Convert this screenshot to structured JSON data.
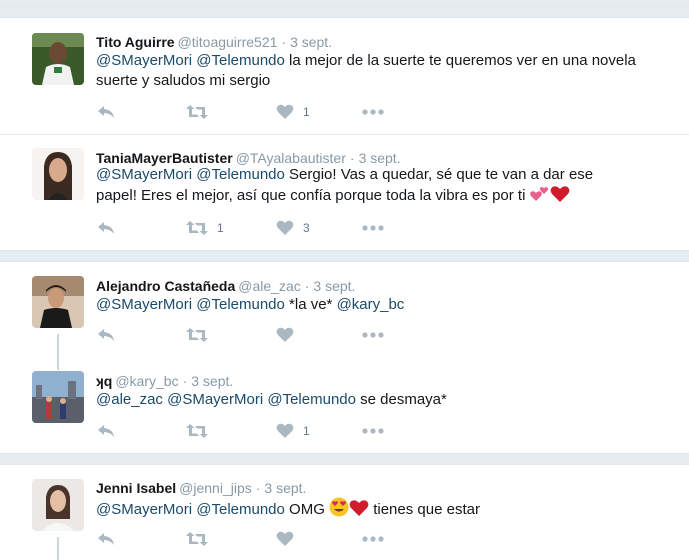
{
  "tweets": [
    {
      "name": "Tito Aguirre",
      "handle": "@titoaguirre521",
      "date": "3 sept.",
      "mentions": [
        "@SMayerMori",
        "@Telemundo"
      ],
      "body": "la mejor de la suerte te queremos ver en una novela suerte y saludos mi sergio",
      "retweets": "",
      "likes": "1"
    },
    {
      "name": "TaniaMayerBautister",
      "handle": "@TAyalabautister",
      "date": "3 sept.",
      "mentions": [
        "@SMayerMori",
        "@Telemundo"
      ],
      "body": "Sergio! Vas a quedar, sé que te van a dar ese papel! Eres el mejor, así que confía porque toda la vibra es por ti",
      "retweets": "1",
      "likes": "3"
    },
    {
      "name": "Alejandro Castañeda",
      "handle": "@ale_zac",
      "date": "3 sept.",
      "mentions": [
        "@SMayerMori",
        "@Telemundo"
      ],
      "body": "*la ve*",
      "trailing_mention": "@kary_bc",
      "retweets": "",
      "likes": ""
    },
    {
      "name": "ʞq",
      "handle": "@kary_bc",
      "date": "3 sept.",
      "mentions": [
        "@ale_zac",
        "@SMayerMori",
        "@Telemundo"
      ],
      "body": "se desmaya*",
      "retweets": "",
      "likes": "1"
    },
    {
      "name": "Jenni Isabel",
      "handle": "@jenni_jips",
      "date": "3 sept.",
      "mentions": [
        "@SMayerMori",
        "@Telemundo"
      ],
      "body": "OMG",
      "body_after": "tienes que estar",
      "retweets": "",
      "likes": ""
    }
  ],
  "icons": {
    "reply": "reply-icon",
    "retweet": "retweet-icon",
    "like": "heart-icon",
    "more": "more-icon"
  },
  "colors": {
    "mention": "#1b4a6b",
    "meta": "#8899a6",
    "icon": "#aab8c2"
  }
}
